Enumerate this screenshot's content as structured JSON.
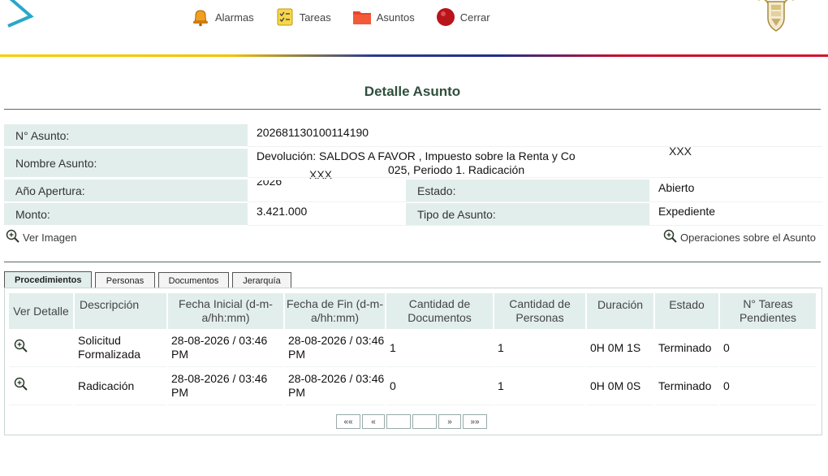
{
  "nav": {
    "items": [
      {
        "label": "Alarmas",
        "icon": "alarm-bell-icon"
      },
      {
        "label": "Tareas",
        "icon": "task-list-icon"
      },
      {
        "label": "Asuntos",
        "icon": "folder-icon"
      },
      {
        "label": "Cerrar",
        "icon": "close-session-icon"
      }
    ]
  },
  "page_title": "Detalle Asunto",
  "detail": {
    "numero_label": "N° Asunto:",
    "numero_value": "202681130100114190",
    "nombre_label": "Nombre Asunto:",
    "nombre_line1": "Devolución: SALDOS A FAVOR , Impuesto sobre la Renta y Co",
    "nombre_line2": "025, Periodo 1. Radicación",
    "redacted_1": "XXX",
    "redacted_2": "XXX",
    "anio_label": "Año Apertura:",
    "anio_value": "2026",
    "estado_label": "Estado:",
    "estado_value": "Abierto",
    "monto_label": "Monto:",
    "monto_value": "3.421.000",
    "tipo_label": "Tipo de Asunto:",
    "tipo_value": "Expediente"
  },
  "links": {
    "ver_imagen": "Ver Imagen",
    "operaciones": "Operaciones sobre el Asunto"
  },
  "tabs": [
    "Procedimientos",
    "Personas",
    "Documentos",
    "Jerarquía"
  ],
  "table": {
    "headers": [
      "Ver Detalle",
      "Descripción",
      "Fecha Inicial (d-m-a/hh:mm)",
      "Fecha de Fin (d-m-a/hh:mm)",
      "Cantidad de Documentos",
      "Cantidad de Personas",
      "Duración",
      "Estado",
      "N° Tareas Pendientes"
    ],
    "rows": [
      {
        "descripcion": "Solicitud Formalizada",
        "fecha_inicial": "28-08-2026 / 03:46 PM",
        "fecha_fin": "28-08-2026 / 03:46 PM",
        "documentos": "1",
        "personas": "1",
        "duracion": "0H 0M 1S",
        "estado": "Terminado",
        "pendientes": "0"
      },
      {
        "descripcion": "Radicación",
        "fecha_inicial": "28-08-2026 / 03:46 PM",
        "fecha_fin": "28-08-2026 / 03:46 PM",
        "documentos": "0",
        "personas": "1",
        "duracion": "0H 0M 0S",
        "estado": "Terminado",
        "pendientes": "0"
      }
    ]
  },
  "pager": {
    "first": "««",
    "prev": "«",
    "next": "»",
    "last": "»»"
  },
  "colors": {
    "label_bg": "#e2eeec",
    "title": "#2f4f3c",
    "flag_yellow": "#f5d000",
    "flag_blue": "#1e2f88",
    "flag_red": "#c8102e"
  }
}
